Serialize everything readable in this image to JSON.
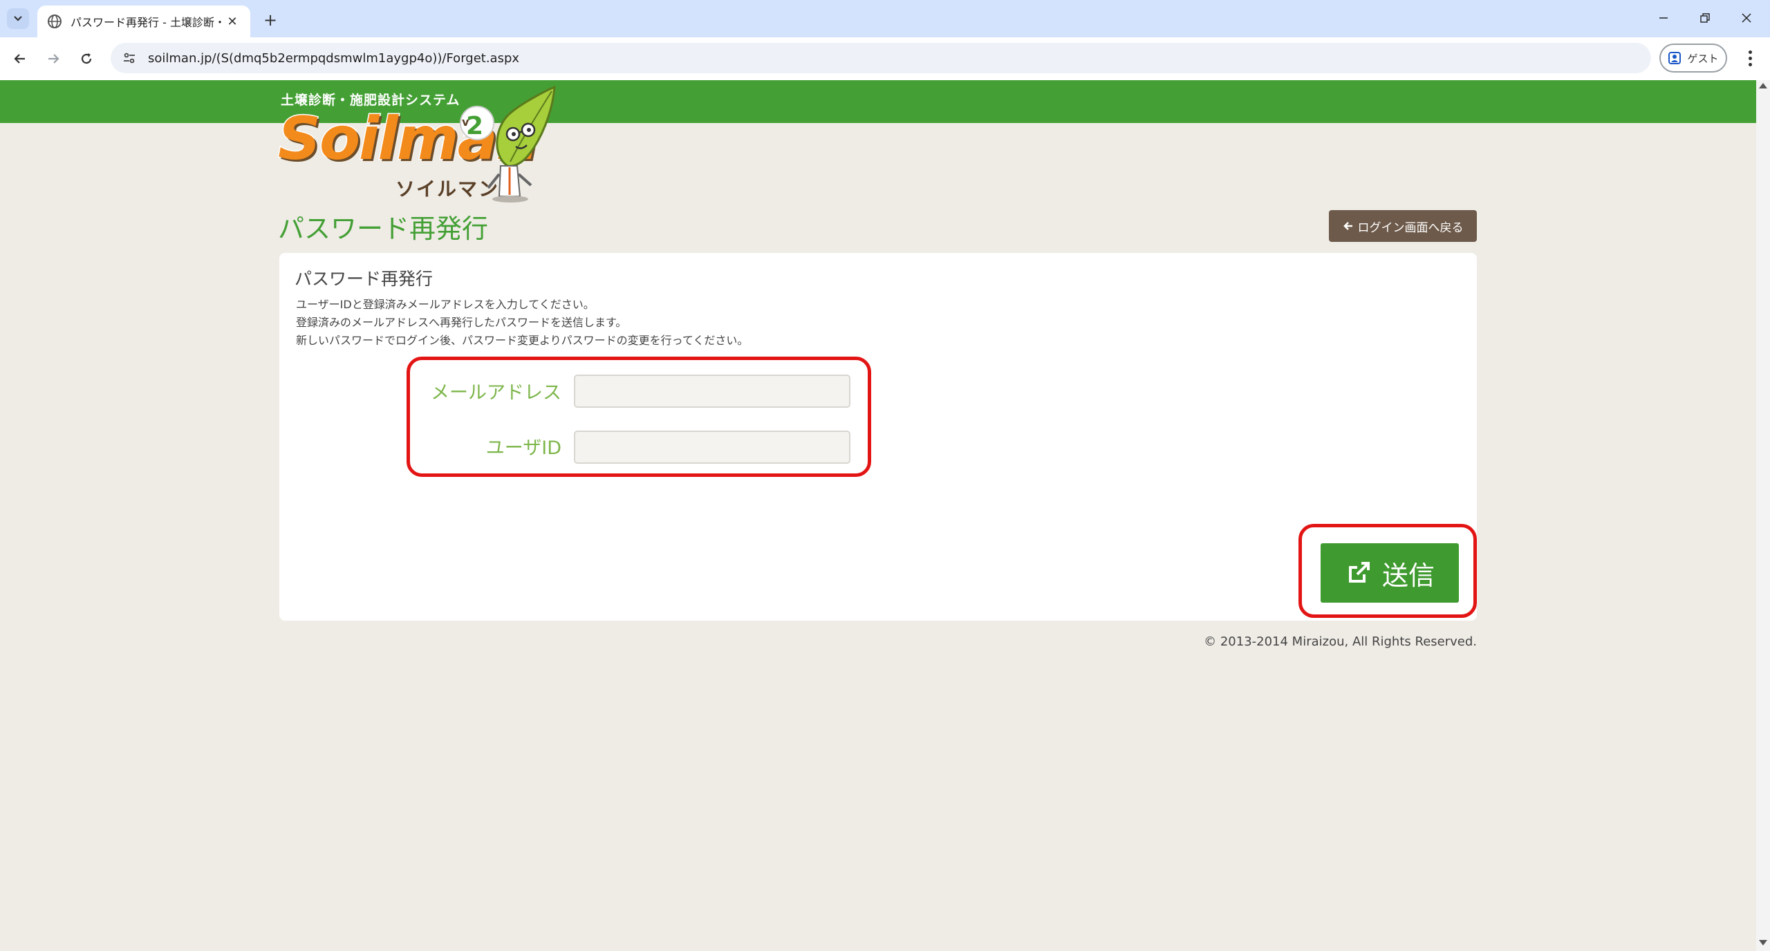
{
  "browser": {
    "tab_title": "パスワード再発行 - 土壌診断・施",
    "url": "soilman.jp/(S(dmq5b2ermpqdsmwlm1aygp4o))/Forget.aspx",
    "profile_label": "ゲスト",
    "new_tab_symbol": "+",
    "close_symbol": "✕"
  },
  "logo": {
    "tagline": "土壌診断・施肥設計システム",
    "wordmark": "Soilman",
    "kana": "ソイルマン",
    "version": "v2"
  },
  "page": {
    "title": "パスワード再発行",
    "back_button": "ログイン画面へ戻る"
  },
  "form": {
    "heading": "パスワード再発行",
    "instructions": [
      "ユーザーIDと登録済みメールアドレスを入力してください。",
      "登録済みのメールアドレスへ再発行したパスワードを送信します。",
      "新しいパスワードでログイン後、パスワード変更よりパスワードの変更を行ってください。"
    ],
    "email_label": "メールアドレス",
    "email_value": "",
    "userid_label": "ユーザID",
    "userid_value": "",
    "submit_label": "送信"
  },
  "footer": {
    "copyright": "© 2013-2014 Miraizou, All Rights Reserved."
  },
  "colors": {
    "brand_green": "#44a035",
    "label_green": "#7db64a",
    "highlight_red": "#e31414",
    "back_button_brown": "#6d5a4a",
    "logo_orange": "#f38a1c"
  }
}
